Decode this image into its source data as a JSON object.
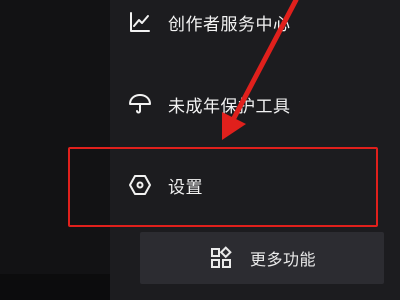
{
  "menu": {
    "creator_center": {
      "label": "创作者服务中心",
      "icon": "chart-line-icon"
    },
    "minor_protection": {
      "label": "未成年保护工具",
      "icon": "umbrella-icon"
    },
    "settings": {
      "label": "设置",
      "icon": "hexagon-settings-icon"
    }
  },
  "more_button": {
    "label": "更多功能",
    "icon": "grid-apps-icon"
  },
  "annotation": {
    "color": "#e0201c"
  }
}
